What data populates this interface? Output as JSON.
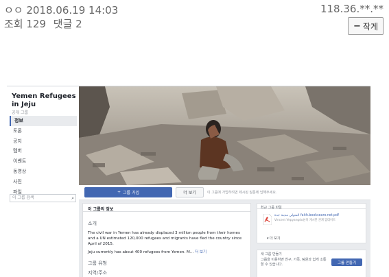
{
  "post": {
    "author": "ㅇㅇ 2018.06.19 14:03",
    "ip": "118.36.**.**",
    "views_label": "조회 129",
    "comments_label": "댓글 2",
    "shrink_label": "작게"
  },
  "group": {
    "name": "Yemen Refugees in Jeju",
    "type": "공개 그룹",
    "nav": [
      "정보",
      "토론",
      "공지",
      "멤버",
      "이벤트",
      "동영상",
      "사진",
      "파일"
    ],
    "nav_more": "더 보기",
    "search_placeholder": "이 그룹 검색",
    "join_button": "그룹 가입",
    "more_button": "더 보기",
    "action_note": "이 그룹에 가입하려면 제시된 질문에 답해주세요."
  },
  "about": {
    "header": "이 그룹의 정보",
    "intro_label": "소개",
    "description": "The civil war in Yemen has already displaced 3 million people from their homes and a UN estimated 120,000 refugees and migrants have fled the country since April of 2015.",
    "description2": "Jeju currently has about 400 refugees from Yemen. M...",
    "more_link": "더 보기",
    "group_type_label": "그룹 유형",
    "location_label": "지역/주소"
  },
  "recent_files": {
    "header": "최근 그룹 파일",
    "file_name": "المتولي مدينة جدة faith.booksearo.net.pdf",
    "file_desc": "Vincent Vepyangdo님이 게시한 관계 업데이트",
    "more": "더 보기"
  },
  "create_group": {
    "title": "새 그룹 만들기",
    "description": "그룹을 이용하면 친구, 가족, 팀원과 쉽게 소통할 수 있습니다.",
    "button": "그룹 만들기"
  },
  "colors": {
    "fb_blue": "#4267b2",
    "page_bg": "#e9ebee"
  },
  "icons": {
    "search": "search-icon",
    "pdf": "pdf-file-icon",
    "plus": "plus-icon"
  }
}
